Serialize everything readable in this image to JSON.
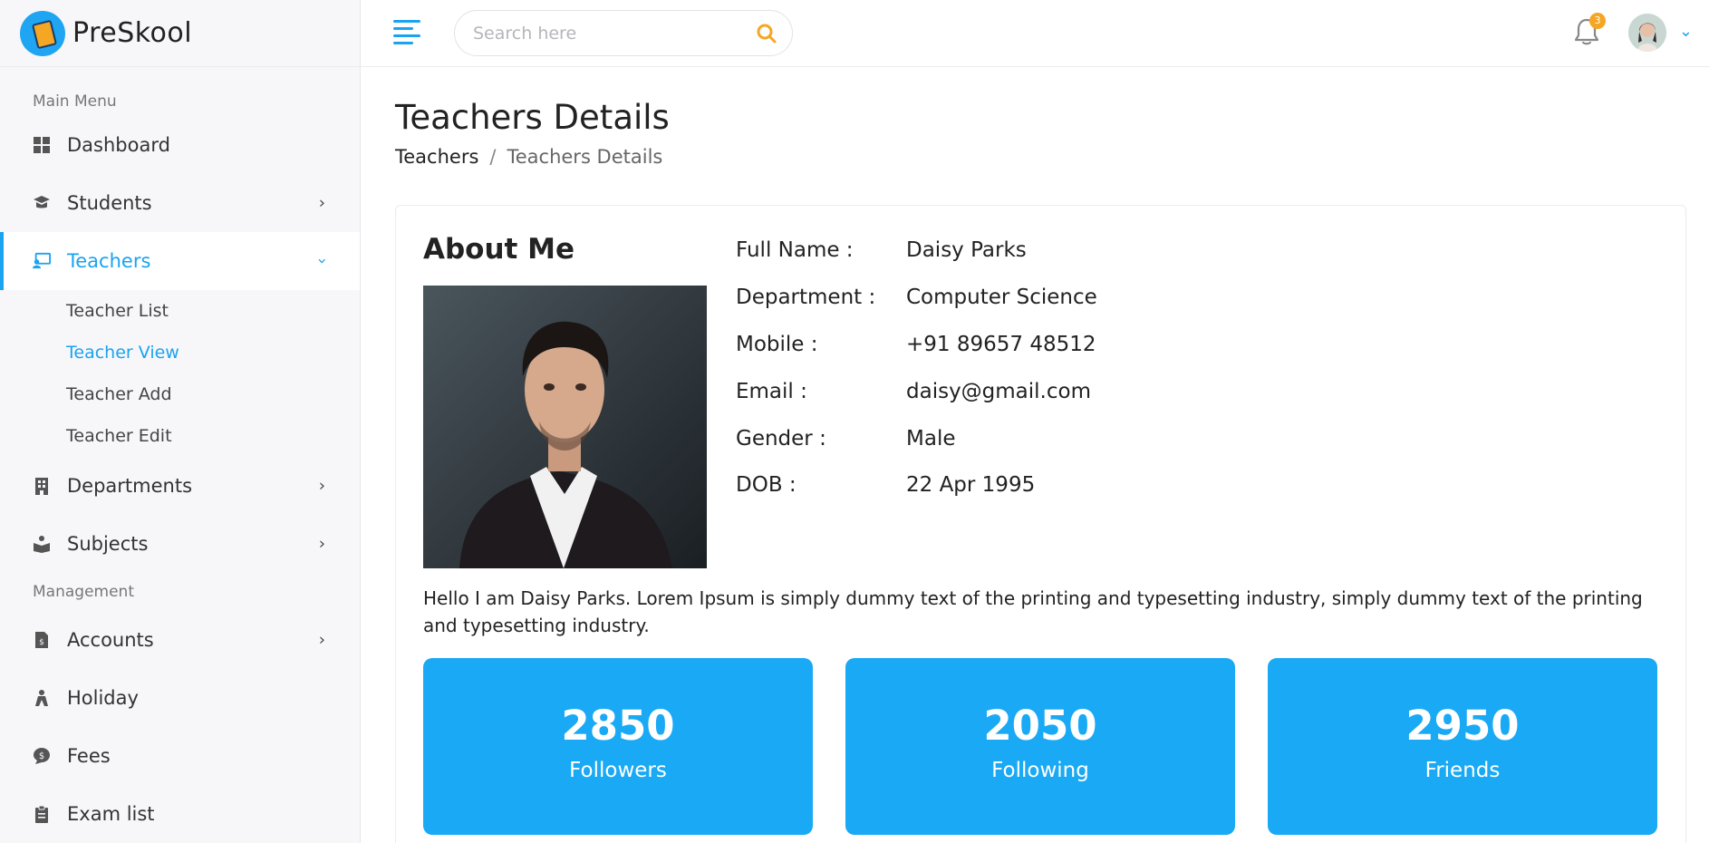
{
  "brand": {
    "name": "PreSkool"
  },
  "sidebar": {
    "main_menu_title": "Main Menu",
    "management_title": "Management",
    "items": [
      {
        "label": "Dashboard"
      },
      {
        "label": "Students"
      },
      {
        "label": "Teachers"
      },
      {
        "label": "Departments"
      },
      {
        "label": "Subjects"
      },
      {
        "label": "Accounts"
      },
      {
        "label": "Holiday"
      },
      {
        "label": "Fees"
      },
      {
        "label": "Exam list"
      }
    ],
    "teacher_sub": [
      {
        "label": "Teacher List"
      },
      {
        "label": "Teacher View"
      },
      {
        "label": "Teacher Add"
      },
      {
        "label": "Teacher Edit"
      }
    ]
  },
  "header": {
    "search_placeholder": "Search here",
    "notification_count": "3"
  },
  "page": {
    "title": "Teachers Details",
    "breadcrumb": [
      "Teachers",
      "Teachers Details"
    ]
  },
  "profile": {
    "section_title": "About Me",
    "fields": [
      {
        "label": "Full Name :",
        "value": "Daisy Parks"
      },
      {
        "label": "Department :",
        "value": "Computer Science"
      },
      {
        "label": "Mobile :",
        "value": "+91 89657 48512"
      },
      {
        "label": "Email :",
        "value": "daisy@gmail.com"
      },
      {
        "label": "Gender :",
        "value": "Male"
      },
      {
        "label": "DOB :",
        "value": "22 Apr 1995"
      }
    ],
    "about": "Hello I am Daisy Parks. Lorem Ipsum is simply dummy text of the printing and typesetting industry, simply dummy text of the printing and typesetting industry."
  },
  "stats": [
    {
      "value": "2850",
      "label": "Followers"
    },
    {
      "value": "2050",
      "label": "Following"
    },
    {
      "value": "2950",
      "label": "Friends"
    }
  ],
  "colors": {
    "accent": "#1aa3f0",
    "stat_bg": "#19a9f5",
    "badge": "#f5a623"
  }
}
